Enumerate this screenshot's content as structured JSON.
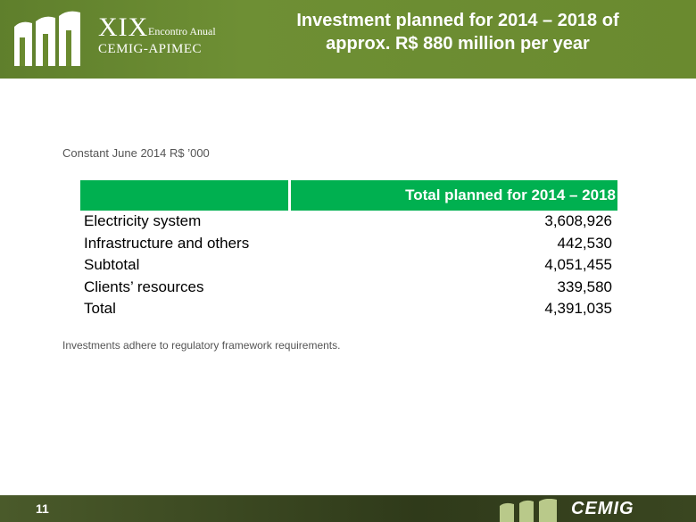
{
  "header": {
    "logo": {
      "roman": "XIX",
      "sub": "Encontro Anual",
      "name": "CEMIG-APIMEC"
    },
    "title_line1": "Investment planned for 2014 – 2018 of",
    "title_line2": "approx. R$ 880 million per year"
  },
  "subtitle": "Constant June 2014 R$ ’000",
  "table": {
    "header": "Total planned for 2014 – 2018",
    "rows": [
      {
        "label": "Electricity system",
        "value": "3,608,926"
      },
      {
        "label": "Infrastructure and others",
        "value": "442,530"
      },
      {
        "label": "Subtotal",
        "value": "4,051,455"
      },
      {
        "label": "Clients’ resources",
        "value": "339,580"
      },
      {
        "label": "Total",
        "value": "4,391,035"
      }
    ]
  },
  "note": "Investments adhere to regulatory framework requirements.",
  "footer": {
    "page_number": "11",
    "brand": "CEMIG"
  },
  "colors": {
    "header_green": "#6a8a2f",
    "table_header_green": "#00b050",
    "footer_dark": "#2f3a1a"
  }
}
